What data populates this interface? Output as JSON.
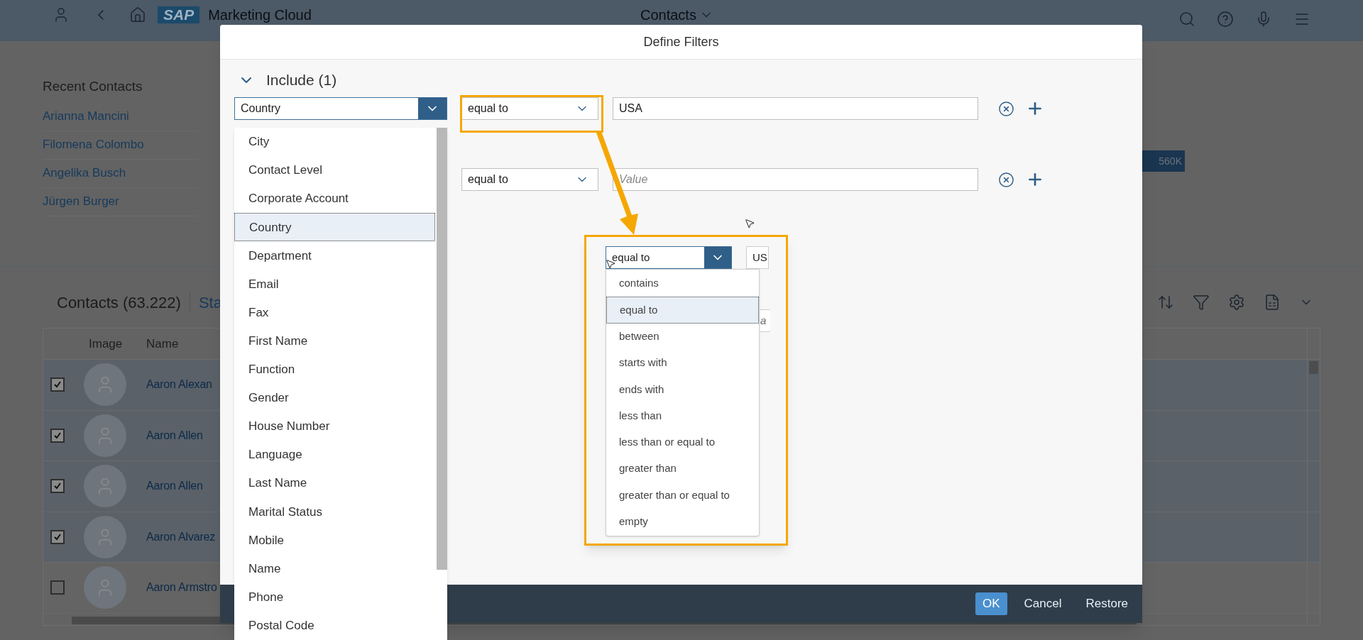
{
  "shell_bar": {
    "title": "Marketing Cloud",
    "app_menu": "Contacts",
    "logo": "SAP"
  },
  "recent_contacts": {
    "title": "Recent Contacts",
    "items": [
      "Arianna Mancini",
      "Filomena Colombo",
      "Angelika Busch",
      "Jürgen Burger"
    ]
  },
  "kpi": {
    "value": "560K"
  },
  "contacts_table": {
    "title": "Contacts (63.222)",
    "variant": "Sta",
    "columns": [
      "Image",
      "Name"
    ],
    "rows": [
      {
        "name": "Aaron Alexan",
        "selected": true
      },
      {
        "name": "Aaron Allen",
        "selected": true
      },
      {
        "name": "Aaron Allen",
        "selected": true
      },
      {
        "name": "Aaron Alvarez",
        "selected": true
      },
      {
        "name": "Aaron Armstro",
        "selected": false
      }
    ]
  },
  "dialog": {
    "title": "Define Filters",
    "section": {
      "label": "Include (1)",
      "expanded": true
    },
    "rows": [
      {
        "field": "Country",
        "operator": "equal to",
        "value": "USA"
      },
      {
        "operator": "equal to",
        "placeholder": "Value"
      }
    ],
    "field_dropdown": {
      "items": [
        {
          "label": "City",
          "selected": false
        },
        {
          "label": "Contact Level",
          "selected": false
        },
        {
          "label": "Corporate Account",
          "selected": false
        },
        {
          "label": "Country",
          "selected": true
        },
        {
          "label": "Department",
          "selected": false
        },
        {
          "label": "Email",
          "selected": false
        },
        {
          "label": "Fax",
          "selected": false
        },
        {
          "label": "First Name",
          "selected": false
        },
        {
          "label": "Function",
          "selected": false
        },
        {
          "label": "Gender",
          "selected": false
        },
        {
          "label": "House Number",
          "selected": false
        },
        {
          "label": "Language",
          "selected": false
        },
        {
          "label": "Last Name",
          "selected": false
        },
        {
          "label": "Marital Status",
          "selected": false
        },
        {
          "label": "Mobile",
          "selected": false
        },
        {
          "label": "Name",
          "selected": false
        },
        {
          "label": "Phone",
          "selected": false
        },
        {
          "label": "Postal Code",
          "selected": false
        }
      ]
    },
    "buttons": [
      {
        "label": "OK",
        "kind": "primary"
      },
      {
        "label": "Cancel",
        "kind": "plain"
      },
      {
        "label": "Restore",
        "kind": "plain"
      }
    ]
  },
  "callout": {
    "operator": "equal to",
    "value": "US",
    "hidden_placeholder": "a",
    "options": [
      {
        "label": "contains",
        "selected": false
      },
      {
        "label": "equal to",
        "selected": true
      },
      {
        "label": "between",
        "selected": false
      },
      {
        "label": "starts with",
        "selected": false
      },
      {
        "label": "ends with",
        "selected": false
      },
      {
        "label": "less than",
        "selected": false
      },
      {
        "label": "less than or equal to",
        "selected": false
      },
      {
        "label": "greater than",
        "selected": false
      },
      {
        "label": "greater than or equal to",
        "selected": false
      },
      {
        "label": "empty",
        "selected": false
      }
    ]
  }
}
